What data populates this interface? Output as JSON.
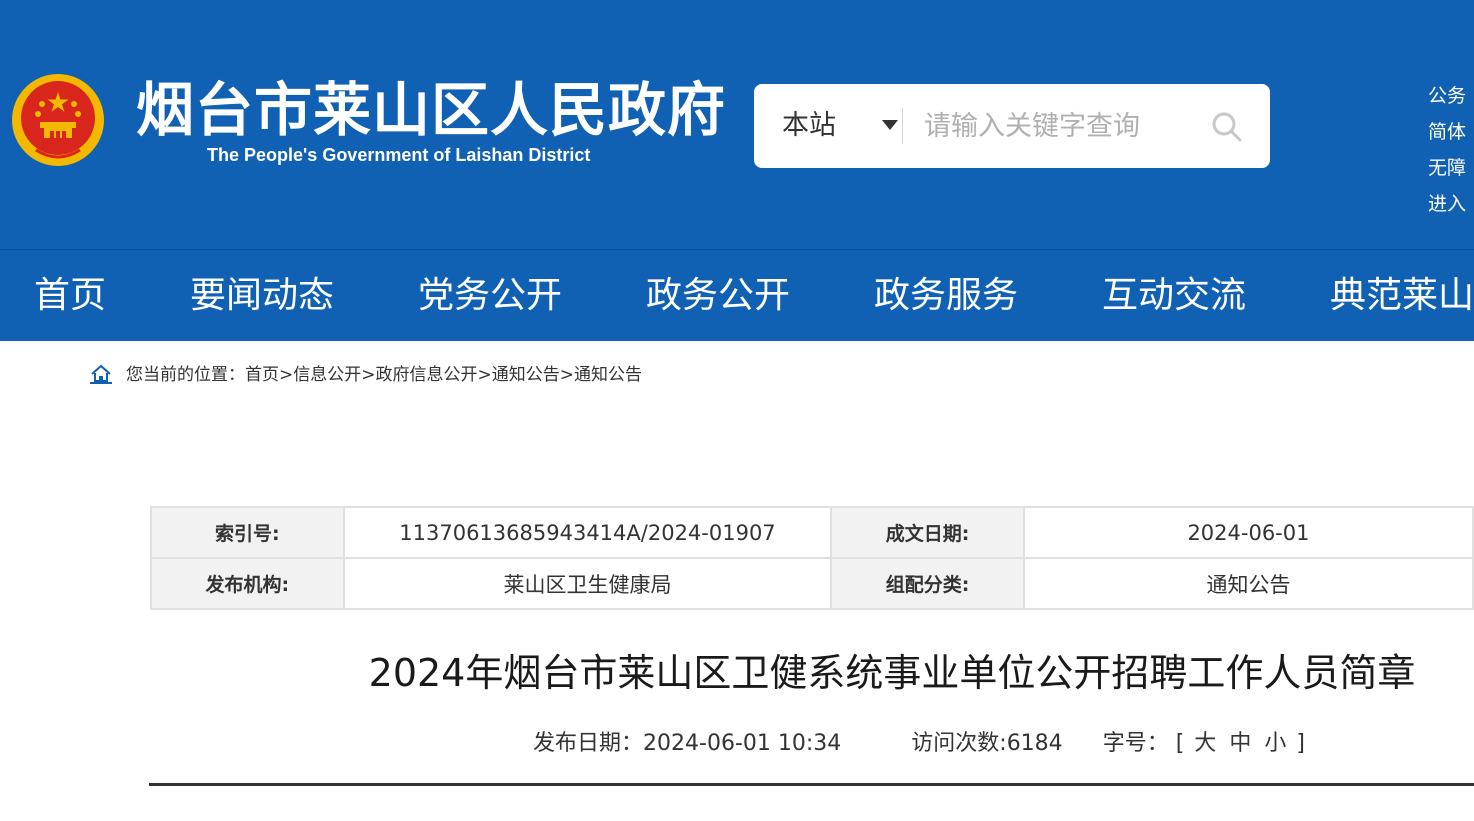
{
  "header": {
    "site_title": "烟台市莱山区人民政府",
    "site_subtitle": "The People's Government of Laishan District",
    "search": {
      "scope_label": "本站",
      "placeholder": "请输入关键字查询"
    },
    "top_links": [
      {
        "label": "公务"
      },
      {
        "label": "简体"
      },
      {
        "label": "无障"
      },
      {
        "label": "进入"
      }
    ]
  },
  "nav": {
    "items": [
      {
        "label": "首页"
      },
      {
        "label": "要闻动态"
      },
      {
        "label": "党务公开"
      },
      {
        "label": "政务公开"
      },
      {
        "label": "政务服务"
      },
      {
        "label": "互动交流"
      },
      {
        "label": "典范莱山"
      }
    ]
  },
  "breadcrumb": {
    "prefix": "您当前的位置：",
    "separator": ">",
    "items": [
      {
        "label": "首页"
      },
      {
        "label": "信息公开"
      },
      {
        "label": "政府信息公开"
      },
      {
        "label": "通知公告"
      },
      {
        "label": "通知公告"
      }
    ]
  },
  "meta": {
    "index_label": "索引号:",
    "index_value": "11370613685943414A/2024-01907",
    "date_label": "成文日期:",
    "date_value": "2024-06-01",
    "org_label": "发布机构:",
    "org_value": "莱山区卫生健康局",
    "category_label": "组配分类:",
    "category_value": "通知公告"
  },
  "article": {
    "title": "2024年烟台市莱山区卫健系统事业单位公开招聘工作人员简章",
    "publish_label": "发布日期：",
    "publish_value": "2024-06-01 10:34",
    "visits_label": "访问次数:",
    "visits_value": "6184",
    "fontsize_label": "字号：",
    "fontsize_open": "[",
    "fontsize_close": "]",
    "fontsize_large": "大",
    "fontsize_medium": "中",
    "fontsize_small": "小"
  },
  "colors": {
    "brand_blue": "#1060b4",
    "text_dark": "#333333",
    "emblem_red": "#d8261c",
    "emblem_gold": "#f3b800"
  }
}
